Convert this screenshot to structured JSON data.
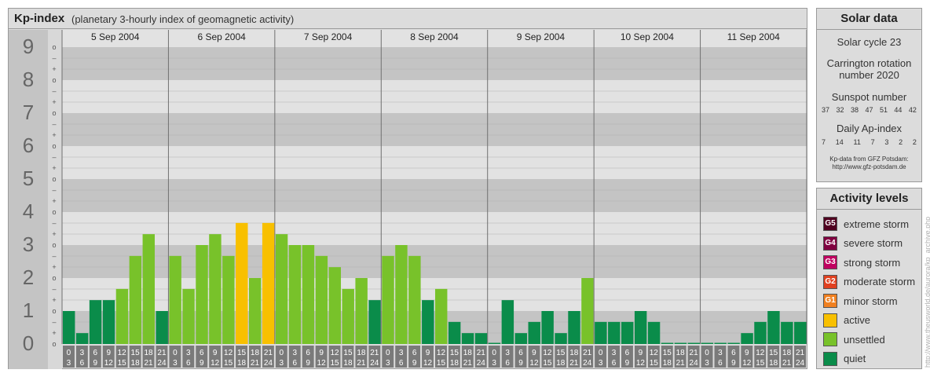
{
  "header": {
    "title": "Kp-index",
    "subtitle": "(planetary 3-hourly index of geomagnetic activity)"
  },
  "chart_data": {
    "type": "bar",
    "ylim": [
      0,
      9
    ],
    "y_major_ticks": [
      "0",
      "1",
      "2",
      "3",
      "4",
      "5",
      "6",
      "7",
      "8",
      "9"
    ],
    "y_minor_ticks": [
      "o",
      "+",
      "–",
      "o"
    ],
    "days": [
      "5 Sep 2004",
      "6 Sep 2004",
      "7 Sep 2004",
      "8 Sep 2004",
      "9 Sep 2004",
      "10 Sep 2004",
      "11 Sep 2004"
    ],
    "interval_start_hours": [
      "0",
      "3",
      "6",
      "9",
      "12",
      "15",
      "18",
      "21"
    ],
    "interval_end_hours": [
      "3",
      "6",
      "9",
      "12",
      "15",
      "18",
      "21",
      "24"
    ],
    "values": [
      [
        1.0,
        0.33,
        1.33,
        1.33,
        1.67,
        2.67,
        3.33,
        1.0
      ],
      [
        2.67,
        1.67,
        3.0,
        3.33,
        2.67,
        3.67,
        2.0,
        3.67
      ],
      [
        3.33,
        3.0,
        3.0,
        2.67,
        2.33,
        1.67,
        2.0,
        1.33
      ],
      [
        2.67,
        3.0,
        2.67,
        1.33,
        1.67,
        0.67,
        0.33,
        0.33
      ],
      [
        0.0,
        1.33,
        0.33,
        0.67,
        1.0,
        0.33,
        1.0,
        2.0
      ],
      [
        0.67,
        0.67,
        0.67,
        1.0,
        0.67,
        0.0,
        0.0,
        0.0
      ],
      [
        0.0,
        0.0,
        0.0,
        0.33,
        0.67,
        1.0,
        0.67,
        0.67
      ]
    ],
    "colors": {
      "quiet": "#0a8c4a",
      "unsettled": "#78c22a",
      "active": "#f8c000",
      "minor_storm": "#f08020",
      "moderate_storm": "#e04020",
      "strong_storm": "#c00060",
      "severe_storm": "#800040",
      "extreme_storm": "#500020"
    }
  },
  "solar": {
    "title": "Solar data",
    "cycle": "Solar cycle 23",
    "carrington_1": "Carrington rotation",
    "carrington_2": "number 2020",
    "sunspot_title": "Sunspot number",
    "sunspots": [
      "37",
      "32",
      "38",
      "47",
      "51",
      "44",
      "42"
    ],
    "ap_title": "Daily Ap-index",
    "ap": [
      "7",
      "14",
      "11",
      "7",
      "3",
      "2",
      "2"
    ],
    "source_1": "Kp-data from GFZ Potsdam:",
    "source_2": "http://www.gfz-potsdam.de"
  },
  "activity": {
    "title": "Activity levels",
    "levels": [
      {
        "code": "G5",
        "label": "extreme storm",
        "color": "#500020"
      },
      {
        "code": "G4",
        "label": "severe storm",
        "color": "#800040"
      },
      {
        "code": "G3",
        "label": "strong storm",
        "color": "#c00060"
      },
      {
        "code": "G2",
        "label": "moderate storm",
        "color": "#e04020"
      },
      {
        "code": "G1",
        "label": "minor storm",
        "color": "#f08020"
      },
      {
        "code": "",
        "label": "active",
        "color": "#f8c000"
      },
      {
        "code": "",
        "label": "unsettled",
        "color": "#78c22a"
      },
      {
        "code": "",
        "label": "quiet",
        "color": "#0a8c4a"
      }
    ]
  },
  "watermark": "http://www.theusworld.de/aurora/kp_archive.php"
}
